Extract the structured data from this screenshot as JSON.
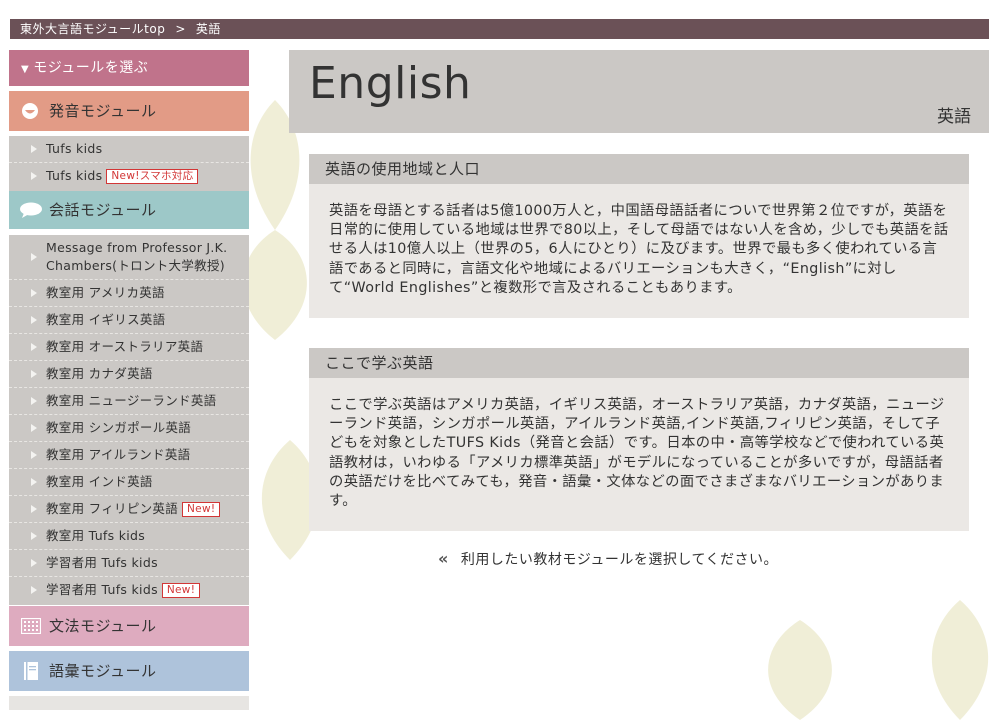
{
  "breadcrumb": {
    "home": "東外大言語モジュールtop",
    "separator": ">",
    "current": "英語"
  },
  "sidebar": {
    "select_label": "モジュールを選ぶ",
    "pronunciation": {
      "label": "発音モジュール",
      "items": [
        {
          "label": "Tufs kids",
          "badge": ""
        },
        {
          "label": "Tufs kids",
          "badge": "New!スマホ対応"
        }
      ]
    },
    "conversation": {
      "label": "会話モジュール",
      "items": [
        {
          "label": "Message from Professor J.K. Chambers(トロント大学教授)",
          "badge": ""
        },
        {
          "label": "教室用 アメリカ英語",
          "badge": ""
        },
        {
          "label": "教室用 イギリス英語",
          "badge": ""
        },
        {
          "label": "教室用 オーストラリア英語",
          "badge": ""
        },
        {
          "label": "教室用 カナダ英語",
          "badge": ""
        },
        {
          "label": "教室用 ニュージーランド英語",
          "badge": ""
        },
        {
          "label": "教室用 シンガポール英語",
          "badge": ""
        },
        {
          "label": "教室用 アイルランド英語",
          "badge": ""
        },
        {
          "label": "教室用 インド英語",
          "badge": ""
        },
        {
          "label": "教室用 フィリピン英語",
          "badge": "New!"
        },
        {
          "label": "教室用 Tufs kids",
          "badge": ""
        },
        {
          "label": "学習者用 Tufs kids",
          "badge": ""
        },
        {
          "label": "学習者用 Tufs kids",
          "badge": "New!"
        }
      ]
    },
    "grammar": {
      "label": "文法モジュール"
    },
    "vocabulary": {
      "label": "語彙モジュール"
    }
  },
  "main": {
    "title_en": "English",
    "title_ja": "英語",
    "sections": [
      {
        "heading": "英語の使用地域と人口",
        "body": "英語を母語とする話者は5億1000万人と，中国語母語話者についで世界第２位ですが，英語を日常的に使用している地域は世界で80以上，そして母語ではない人を含め，少しでも英語を話せる人は10億人以上（世界の5，6人にひとり）に及びます。世界で最も多く使われている言語であると同時に，言語文化や地域によるバリエーションも大きく，“English”に対して“World Englishes”と複数形で言及されることもあります。"
      },
      {
        "heading": "ここで学ぶ英語",
        "body": "ここで学ぶ英語はアメリカ英語，イギリス英語，オーストラリア英語，カナダ英語，ニュージーランド英語，シンガポール英語，アイルランド英語,インド英語,フィリピン英語，そして子どもを対象としたTUFS Kids（発音と会話）です。日本の中・高等学校などで使われている英語教材は，いわゆる「アメリカ標準英語」がモデルになっていることが多いですが，母語話者の英語だけを比べてみても，発音・語彙・文体などの面でさまざまなバリエーションがあります。"
      }
    ],
    "prompt": "利用したい教材モジュールを選択してください。"
  },
  "colors": {
    "breadcrumb_bg": "#6b5157",
    "select_header": "#c0738b",
    "pronunciation": "#e29b86",
    "conversation": "#9dc8c8",
    "grammar": "#deabbf",
    "vocabulary": "#aec3db",
    "badge": "#d23636"
  }
}
